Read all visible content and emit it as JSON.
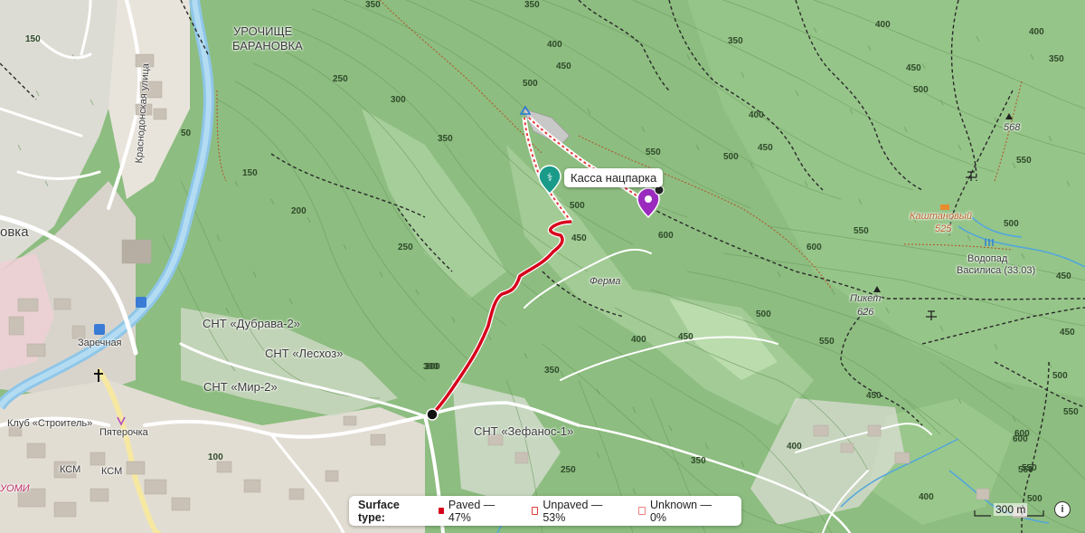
{
  "route": {
    "surface_legend": {
      "title": "Surface type:",
      "paved": "Paved — 47%",
      "unpaved": "Unpaved — 53%",
      "unknown": "Unknown — 0%"
    },
    "colors": {
      "paved": "#d6001c",
      "unpaved": "#e23b3b",
      "unknown": "#f08080"
    }
  },
  "poi": {
    "ticket_office": "Касса нацпарка"
  },
  "places": {
    "urochishche": "УРОЧИЩЕ",
    "baranovka": "БАРАНОВКА",
    "ovka": "овка",
    "zarechnaya": "Заречная",
    "krasnodonskaya": "Краснодонская улица",
    "snt_dubrava": "СНТ «Дубрава-2»",
    "snt_leskhoz": "СНТ «Лесхоз»",
    "snt_mir": "СНТ «Мир-2»",
    "snt_zefanos": "СНТ «Зефанос-1»",
    "klub": "Клуб «Строитель»",
    "pyaterochka": "Пятерочка",
    "ksm1": "КСМ",
    "ksm2": "КСМ",
    "uomi": "УОМИ",
    "ferma": "Ферма",
    "piket": "Пикет",
    "piket_elev": "626",
    "peak568": "568",
    "kashtanovy": "Каштановый",
    "kashtanovy_elev": "525",
    "vodopad": "Водопад",
    "vasilisa": "Василиса (33.03)"
  },
  "contours": [
    "350",
    "400",
    "450",
    "350",
    "500",
    "350",
    "400",
    "450",
    "500",
    "550",
    "500",
    "450",
    "600",
    "400",
    "450",
    "500",
    "550",
    "400",
    "350",
    "300",
    "250",
    "200",
    "150",
    "150",
    "100",
    "50",
    "250",
    "300",
    "350",
    "400",
    "450",
    "500",
    "550",
    "600",
    "550",
    "450",
    "500",
    "550",
    "600",
    "350",
    "400",
    "450",
    "500",
    "550",
    "450",
    "300",
    "250",
    "400",
    "350",
    "600",
    "550",
    "500",
    "400",
    "450",
    "500"
  ],
  "scale": {
    "label": "300 m"
  },
  "info_label": "i"
}
